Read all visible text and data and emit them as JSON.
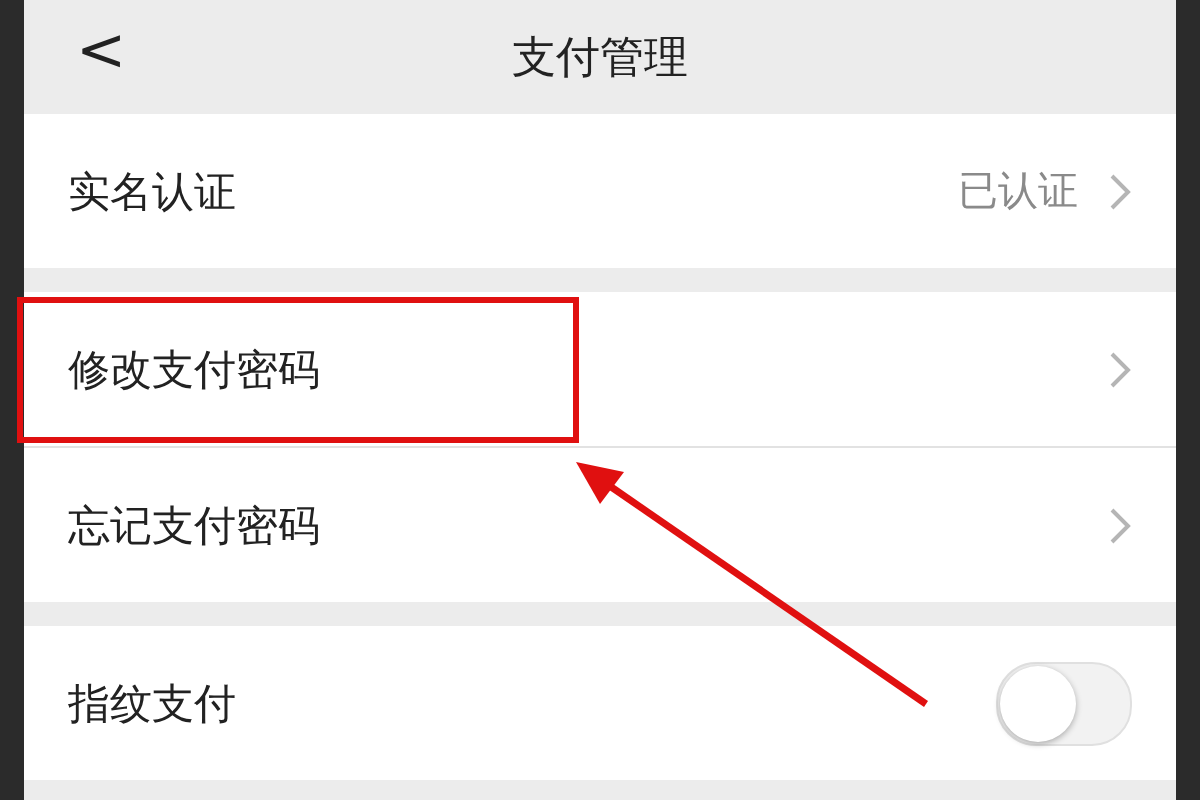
{
  "header": {
    "back_icon": "<",
    "title": "支付管理"
  },
  "groups": [
    {
      "rows": [
        {
          "kind": "link",
          "label": "实名认证",
          "value": "已认证"
        }
      ]
    },
    {
      "rows": [
        {
          "kind": "link",
          "label": "修改支付密码"
        },
        {
          "kind": "link",
          "label": "忘记支付密码"
        }
      ]
    },
    {
      "rows": [
        {
          "kind": "toggle",
          "label": "指纹支付",
          "on": false
        }
      ]
    }
  ]
}
